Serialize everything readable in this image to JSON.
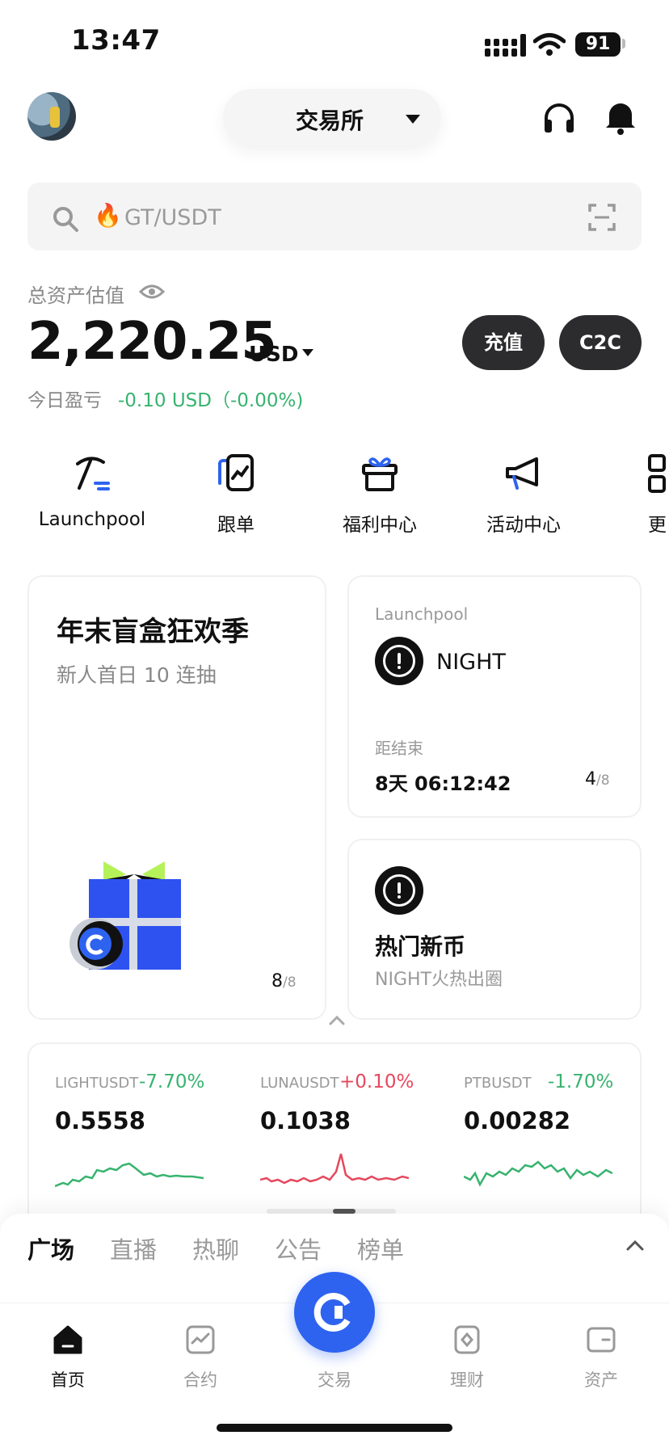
{
  "status_bar": {
    "time": "13:47",
    "battery": "91"
  },
  "header": {
    "exchange_label": "交易所"
  },
  "search": {
    "placeholder": "GT/USDT"
  },
  "assets": {
    "label": "总资产估值",
    "value": "2,220.25",
    "unit": "USD",
    "pnl_label": "今日盈亏",
    "pnl_value": "-0.10 USD（-0.00%)",
    "deposit_label": "充值",
    "c2c_label": "C2C"
  },
  "shortcuts": [
    {
      "label": "Launchpool",
      "icon": "pickaxe-icon"
    },
    {
      "label": "跟单",
      "icon": "copy-trade-icon"
    },
    {
      "label": "福利中心",
      "icon": "gift-icon"
    },
    {
      "label": "活动中心",
      "icon": "megaphone-icon"
    },
    {
      "label": "更",
      "icon": "more-grid-icon"
    }
  ],
  "promo_card": {
    "title": "年末盲盒狂欢季",
    "subtitle": "新人首日 10 连抽",
    "page_current": "8",
    "page_total": "/8"
  },
  "launchpool_card": {
    "label": "Launchpool",
    "coin": "NIGHT",
    "end_label": "距结束",
    "countdown": "8天 06:12:42",
    "page_current": "4",
    "page_total": "/8"
  },
  "hot_card": {
    "title": "热门新币",
    "subtitle": "NIGHT火热出圈"
  },
  "market": [
    {
      "symbol": "LIGHTUSDT",
      "change": "-7.70%",
      "price": "0.5558",
      "trend": "up",
      "color": "#37b36f"
    },
    {
      "symbol": "LUNAUSDT",
      "change": "+0.10%",
      "price": "0.1038",
      "trend": "spike",
      "color": "#e5485d"
    },
    {
      "symbol": "PTBUSDT",
      "change": "-1.70%",
      "price": "0.00282",
      "trend": "flat",
      "color": "#37b36f"
    }
  ],
  "community_tabs": [
    "广场",
    "直播",
    "热聊",
    "公告",
    "榜单"
  ],
  "bottom_nav": [
    "首页",
    "合约",
    "交易",
    "理财",
    "资产"
  ],
  "colors": {
    "accent": "#2e63f0",
    "up_green": "#37b36f",
    "down_red": "#e5485d"
  }
}
